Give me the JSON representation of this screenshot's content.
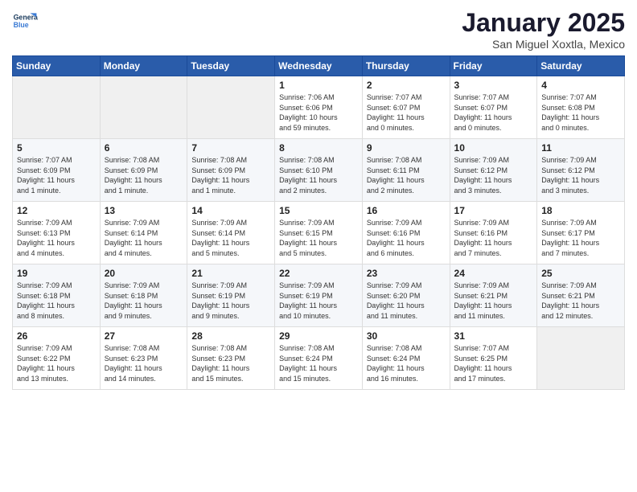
{
  "logo": {
    "line1": "General",
    "line2": "Blue"
  },
  "title": "January 2025",
  "subtitle": "San Miguel Xoxtla, Mexico",
  "headers": [
    "Sunday",
    "Monday",
    "Tuesday",
    "Wednesday",
    "Thursday",
    "Friday",
    "Saturday"
  ],
  "weeks": [
    [
      {
        "num": "",
        "detail": ""
      },
      {
        "num": "",
        "detail": ""
      },
      {
        "num": "",
        "detail": ""
      },
      {
        "num": "1",
        "detail": "Sunrise: 7:06 AM\nSunset: 6:06 PM\nDaylight: 10 hours\nand 59 minutes."
      },
      {
        "num": "2",
        "detail": "Sunrise: 7:07 AM\nSunset: 6:07 PM\nDaylight: 11 hours\nand 0 minutes."
      },
      {
        "num": "3",
        "detail": "Sunrise: 7:07 AM\nSunset: 6:07 PM\nDaylight: 11 hours\nand 0 minutes."
      },
      {
        "num": "4",
        "detail": "Sunrise: 7:07 AM\nSunset: 6:08 PM\nDaylight: 11 hours\nand 0 minutes."
      }
    ],
    [
      {
        "num": "5",
        "detail": "Sunrise: 7:07 AM\nSunset: 6:09 PM\nDaylight: 11 hours\nand 1 minute."
      },
      {
        "num": "6",
        "detail": "Sunrise: 7:08 AM\nSunset: 6:09 PM\nDaylight: 11 hours\nand 1 minute."
      },
      {
        "num": "7",
        "detail": "Sunrise: 7:08 AM\nSunset: 6:09 PM\nDaylight: 11 hours\nand 1 minute."
      },
      {
        "num": "8",
        "detail": "Sunrise: 7:08 AM\nSunset: 6:10 PM\nDaylight: 11 hours\nand 2 minutes."
      },
      {
        "num": "9",
        "detail": "Sunrise: 7:08 AM\nSunset: 6:11 PM\nDaylight: 11 hours\nand 2 minutes."
      },
      {
        "num": "10",
        "detail": "Sunrise: 7:09 AM\nSunset: 6:12 PM\nDaylight: 11 hours\nand 3 minutes."
      },
      {
        "num": "11",
        "detail": "Sunrise: 7:09 AM\nSunset: 6:12 PM\nDaylight: 11 hours\nand 3 minutes."
      }
    ],
    [
      {
        "num": "12",
        "detail": "Sunrise: 7:09 AM\nSunset: 6:13 PM\nDaylight: 11 hours\nand 4 minutes."
      },
      {
        "num": "13",
        "detail": "Sunrise: 7:09 AM\nSunset: 6:14 PM\nDaylight: 11 hours\nand 4 minutes."
      },
      {
        "num": "14",
        "detail": "Sunrise: 7:09 AM\nSunset: 6:14 PM\nDaylight: 11 hours\nand 5 minutes."
      },
      {
        "num": "15",
        "detail": "Sunrise: 7:09 AM\nSunset: 6:15 PM\nDaylight: 11 hours\nand 5 minutes."
      },
      {
        "num": "16",
        "detail": "Sunrise: 7:09 AM\nSunset: 6:16 PM\nDaylight: 11 hours\nand 6 minutes."
      },
      {
        "num": "17",
        "detail": "Sunrise: 7:09 AM\nSunset: 6:16 PM\nDaylight: 11 hours\nand 7 minutes."
      },
      {
        "num": "18",
        "detail": "Sunrise: 7:09 AM\nSunset: 6:17 PM\nDaylight: 11 hours\nand 7 minutes."
      }
    ],
    [
      {
        "num": "19",
        "detail": "Sunrise: 7:09 AM\nSunset: 6:18 PM\nDaylight: 11 hours\nand 8 minutes."
      },
      {
        "num": "20",
        "detail": "Sunrise: 7:09 AM\nSunset: 6:18 PM\nDaylight: 11 hours\nand 9 minutes."
      },
      {
        "num": "21",
        "detail": "Sunrise: 7:09 AM\nSunset: 6:19 PM\nDaylight: 11 hours\nand 9 minutes."
      },
      {
        "num": "22",
        "detail": "Sunrise: 7:09 AM\nSunset: 6:19 PM\nDaylight: 11 hours\nand 10 minutes."
      },
      {
        "num": "23",
        "detail": "Sunrise: 7:09 AM\nSunset: 6:20 PM\nDaylight: 11 hours\nand 11 minutes."
      },
      {
        "num": "24",
        "detail": "Sunrise: 7:09 AM\nSunset: 6:21 PM\nDaylight: 11 hours\nand 11 minutes."
      },
      {
        "num": "25",
        "detail": "Sunrise: 7:09 AM\nSunset: 6:21 PM\nDaylight: 11 hours\nand 12 minutes."
      }
    ],
    [
      {
        "num": "26",
        "detail": "Sunrise: 7:09 AM\nSunset: 6:22 PM\nDaylight: 11 hours\nand 13 minutes."
      },
      {
        "num": "27",
        "detail": "Sunrise: 7:08 AM\nSunset: 6:23 PM\nDaylight: 11 hours\nand 14 minutes."
      },
      {
        "num": "28",
        "detail": "Sunrise: 7:08 AM\nSunset: 6:23 PM\nDaylight: 11 hours\nand 15 minutes."
      },
      {
        "num": "29",
        "detail": "Sunrise: 7:08 AM\nSunset: 6:24 PM\nDaylight: 11 hours\nand 15 minutes."
      },
      {
        "num": "30",
        "detail": "Sunrise: 7:08 AM\nSunset: 6:24 PM\nDaylight: 11 hours\nand 16 minutes."
      },
      {
        "num": "31",
        "detail": "Sunrise: 7:07 AM\nSunset: 6:25 PM\nDaylight: 11 hours\nand 17 minutes."
      },
      {
        "num": "",
        "detail": ""
      }
    ]
  ]
}
